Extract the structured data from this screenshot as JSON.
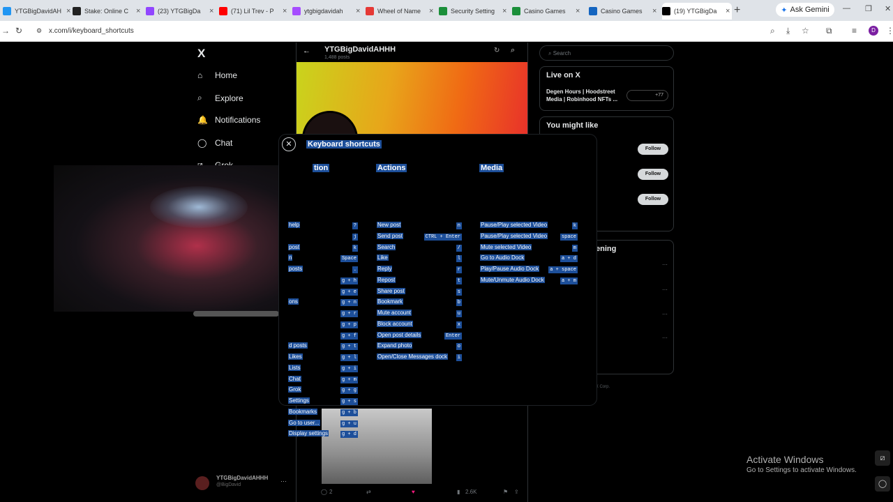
{
  "browser": {
    "tabs": [
      {
        "title": "YTGBigDavidAH",
        "color": "#2196f3"
      },
      {
        "title": "Stake: Online C",
        "color": "#222222"
      },
      {
        "title": "(23) YTGBigDa",
        "color": "#9146ff"
      },
      {
        "title": "(71) Lil Trev - P",
        "color": "#ff0000"
      },
      {
        "title": "ytgbigdavidah",
        "color": "#a64dff"
      },
      {
        "title": "Wheel of Name",
        "color": "#e53935"
      },
      {
        "title": "Security Setting",
        "color": "#1b8f3a"
      },
      {
        "title": "Casino Games",
        "color": "#1b8f3a"
      },
      {
        "title": "Casino Games",
        "color": "#1565c0"
      },
      {
        "title": "(19) YTGBigDa",
        "color": "#000000"
      }
    ],
    "new_tab": "+",
    "gemini_label": "Ask Gemini",
    "url": "x.com/i/keyboard_shortcuts",
    "profile_initial": "D"
  },
  "sidebar": {
    "logo": "X",
    "items": [
      {
        "label": "Home",
        "icon": "home-icon"
      },
      {
        "label": "Explore",
        "icon": "search-icon"
      },
      {
        "label": "Notifications",
        "icon": "bell-icon"
      },
      {
        "label": "Chat",
        "icon": "chat-icon"
      },
      {
        "label": "Grok",
        "icon": "grok-icon"
      }
    ],
    "account_name": "YTGBigDavidAHHH",
    "account_handle": "@BigDavid"
  },
  "timeline": {
    "profile_name": "YTGBigDavidAHHH",
    "posts_count": "1,488 posts",
    "post_stats": [
      "2",
      "",
      "",
      "2.6K"
    ]
  },
  "right": {
    "search_placeholder": "Search",
    "live_title": "Live on X",
    "live_text": "Degen Hours | Hoodstreet Media | Robinhood NFTs ...",
    "live_count": "+77",
    "might_like_title": "You might like",
    "follow_label": "Follow",
    "happening_title": "ening",
    "footer": "olicy   Accessibility   © 2026 X Corp."
  },
  "modal": {
    "title": "Keyboard shortcuts",
    "close_icon": "close-icon",
    "navigation": {
      "heading": "tion",
      "rows": [
        {
          "label": "help",
          "key": "?"
        },
        {
          "label": "",
          "key": "j"
        },
        {
          "label": "post",
          "key": "k"
        },
        {
          "label": "n",
          "key": "Space"
        },
        {
          "label": "posts",
          "key": "."
        },
        {
          "label": "",
          "key": "g + h"
        },
        {
          "label": "",
          "key": "g + e"
        },
        {
          "label": "ons",
          "key": "g + n"
        },
        {
          "label": "",
          "key": "g + r"
        },
        {
          "label": "",
          "key": "g + p"
        },
        {
          "label": "",
          "key": "g + f"
        },
        {
          "label": "d posts",
          "key": "g + t"
        },
        {
          "label": "Likes",
          "key": "g + l"
        },
        {
          "label": "Lists",
          "key": "g + i"
        },
        {
          "label": "Chat",
          "key": "g + m"
        },
        {
          "label": "Grok",
          "key": "g + g"
        },
        {
          "label": "Settings",
          "key": "g + s"
        },
        {
          "label": "Bookmarks",
          "key": "g + b"
        },
        {
          "label": "Go to user...",
          "key": "g + u"
        },
        {
          "label": "Display settings",
          "key": "g + d"
        }
      ]
    },
    "actions": {
      "heading": "Actions",
      "rows": [
        {
          "label": "New post",
          "key": "n"
        },
        {
          "label": "Send post",
          "key": "CTRL + Enter"
        },
        {
          "label": "Search",
          "key": "/"
        },
        {
          "label": "Like",
          "key": "l"
        },
        {
          "label": "Reply",
          "key": "r"
        },
        {
          "label": "Repost",
          "key": "t"
        },
        {
          "label": "Share post",
          "key": "s"
        },
        {
          "label": "Bookmark",
          "key": "b"
        },
        {
          "label": "Mute account",
          "key": "u"
        },
        {
          "label": "Block account",
          "key": "x"
        },
        {
          "label": "Open post details",
          "key": "Enter"
        },
        {
          "label": "Expand photo",
          "key": "o"
        },
        {
          "label": "Open/Close Messages dock",
          "key": "i"
        }
      ]
    },
    "media": {
      "heading": "Media",
      "rows": [
        {
          "label": "Pause/Play selected Video",
          "key": "k"
        },
        {
          "label": "Pause/Play selected Video",
          "key": "space"
        },
        {
          "label": "Mute selected Video",
          "key": "m"
        },
        {
          "label": "Go to Audio Dock",
          "key": "a + d"
        },
        {
          "label": "Play/Pause Audio Dock",
          "key": "a + space"
        },
        {
          "label": "Mute/Unmute Audio Dock",
          "key": "a + m"
        }
      ]
    }
  },
  "watermark": {
    "line1": "Activate Windows",
    "line2": "Go to Settings to activate Windows."
  }
}
